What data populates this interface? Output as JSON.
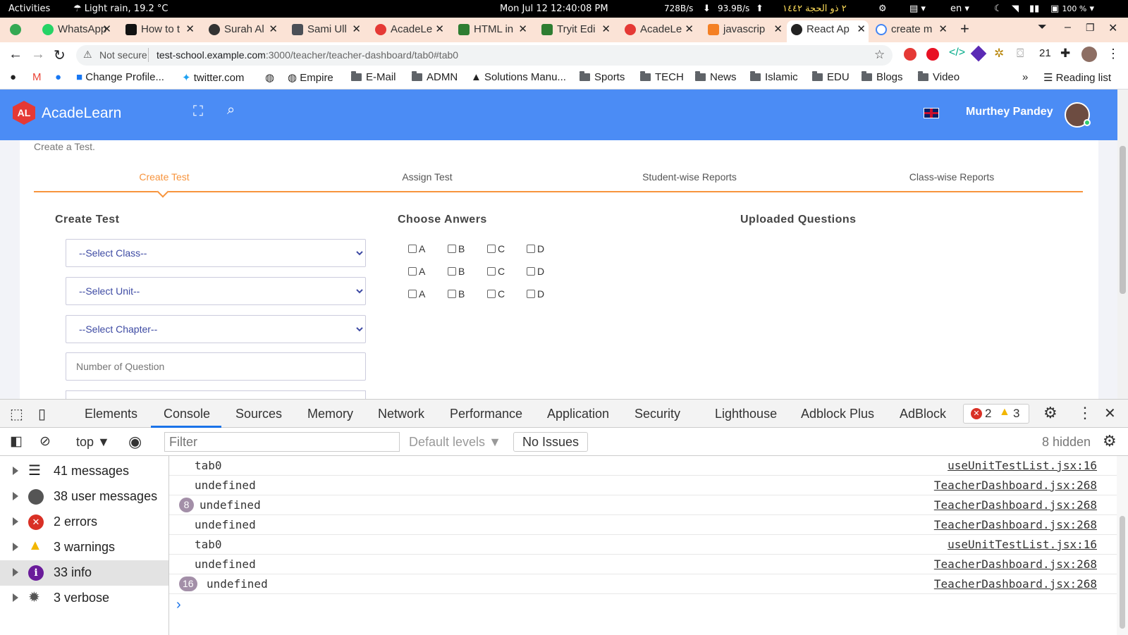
{
  "system_bar": {
    "activities": "Activities",
    "weather": "Light rain, 19.2 °C",
    "clock": "Mon Jul 12  12:40:08 PM",
    "net_down": "728B/s",
    "net_up": "93.9B/s",
    "hijri_date": "٢ ذو الحجة ١٤٤٢",
    "language": "en",
    "battery": "100 %"
  },
  "tabs": [
    {
      "label": "",
      "icon": "green-leaf-icon",
      "color": "#34a853"
    },
    {
      "label": "WhatsApp",
      "icon": "whatsapp-icon",
      "color": "#25d366"
    },
    {
      "label": "How to t",
      "icon": "video-icon",
      "color": "#111111"
    },
    {
      "label": "Surah Al",
      "icon": "globe-dark-icon",
      "color": "#333333"
    },
    {
      "label": "Sami Ull",
      "icon": "linkedin-icon",
      "color": "#4b4f56"
    },
    {
      "label": "AcadeLe",
      "icon": "acadelearn-icon",
      "color": "#e53935"
    },
    {
      "label": "HTML in",
      "icon": "w3-icon",
      "color": "#2e7d32"
    },
    {
      "label": "Tryit Edi",
      "icon": "w3-icon",
      "color": "#2e7d32"
    },
    {
      "label": "AcadeLe",
      "icon": "acadelearn-icon",
      "color": "#e53935"
    },
    {
      "label": "javascrip",
      "icon": "stackoverflow-icon",
      "color": "#f48024"
    },
    {
      "label": "React Ap",
      "icon": "react-icon",
      "color": "#222222",
      "active": true
    },
    {
      "label": "create m",
      "icon": "google-icon",
      "color": "#4285f4"
    }
  ],
  "address_bar": {
    "security": "Not secure",
    "host": "test-school.example.com",
    "path": ":3000/teacher/teacher-dashboard/tab0#tab0"
  },
  "extensions_count": "21",
  "bookmarks": [
    {
      "label": "",
      "icon": "github-icon"
    },
    {
      "label": "",
      "icon": "gmail-icon"
    },
    {
      "label": "",
      "icon": "facebook-icon"
    },
    {
      "label": "Change Profile...",
      "icon": "facebook-icon"
    },
    {
      "label": "twitter.com",
      "icon": "twitter-icon"
    },
    {
      "label": "",
      "icon": "globe-icon"
    },
    {
      "label": "Empire",
      "icon": "globe-icon"
    },
    {
      "label": "E-Mail",
      "icon": "folder-icon"
    },
    {
      "label": "ADMN",
      "icon": "folder-icon"
    },
    {
      "label": "Solutions Manu...",
      "icon": "triangle-icon"
    },
    {
      "label": "Sports",
      "icon": "folder-icon"
    },
    {
      "label": "TECH",
      "icon": "folder-icon"
    },
    {
      "label": "News",
      "icon": "folder-icon"
    },
    {
      "label": "Islamic",
      "icon": "folder-icon"
    },
    {
      "label": "EDU",
      "icon": "folder-icon"
    },
    {
      "label": "Blogs",
      "icon": "folder-icon"
    },
    {
      "label": "Video",
      "icon": "folder-icon"
    }
  ],
  "overflow": "»",
  "reading_list": "Reading list",
  "app": {
    "logo_badge": "AL",
    "logo_text": "AcadeLearn",
    "user_name": "Murthey Pandey",
    "brand_color": "#4b8cf5",
    "accent_color": "#f7943d",
    "page_subtitle": "Create a Test.",
    "nav_tabs": [
      "Create Test",
      "Assign Test",
      "Student-wise Reports",
      "Class-wise Reports"
    ],
    "active_tab": "Create Test",
    "create_test_heading": "Create Test",
    "choose_answers_heading": "Choose Anwers",
    "uploaded_heading": "Uploaded Questions",
    "class_select": "--Select Class--",
    "unit_select": "--Select Unit--",
    "chapter_select": "--Select Chapter--",
    "question_count_placeholder": "Number of Question",
    "answer_options": [
      "A",
      "B",
      "C",
      "D"
    ]
  },
  "devtools": {
    "tabs": [
      "Elements",
      "Console",
      "Sources",
      "Memory",
      "Network",
      "Performance",
      "Application",
      "Security",
      "Lighthouse",
      "Adblock Plus",
      "AdBlock"
    ],
    "active_tab": "Console",
    "error_count": "2",
    "warning_count": "3",
    "context": "top",
    "filter_placeholder": "Filter",
    "levels": "Default levels",
    "issues": "No Issues",
    "hidden": "8 hidden",
    "sidebar": [
      {
        "label": "41 messages",
        "icon": "list-icon"
      },
      {
        "label": "38 user messages",
        "icon": "user-icon"
      },
      {
        "label": "2 errors",
        "icon": "error-icon"
      },
      {
        "label": "3 warnings",
        "icon": "warning-icon"
      },
      {
        "label": "33 info",
        "icon": "info-icon",
        "selected": true
      },
      {
        "label": "3 verbose",
        "icon": "bug-icon"
      }
    ],
    "logs": [
      {
        "count": "",
        "text": "tab0",
        "source": "useUnitTestList.jsx:16"
      },
      {
        "count": "",
        "text": "undefined",
        "source": "TeacherDashboard.jsx:268"
      },
      {
        "count": "8",
        "text": "undefined",
        "source": "TeacherDashboard.jsx:268"
      },
      {
        "count": "",
        "text": "undefined",
        "source": "TeacherDashboard.jsx:268"
      },
      {
        "count": "",
        "text": "tab0",
        "source": "useUnitTestList.jsx:16"
      },
      {
        "count": "",
        "text": "undefined",
        "source": "TeacherDashboard.jsx:268"
      },
      {
        "count": "16",
        "text": "undefined",
        "source": "TeacherDashboard.jsx:268"
      }
    ],
    "prompt": "›"
  }
}
